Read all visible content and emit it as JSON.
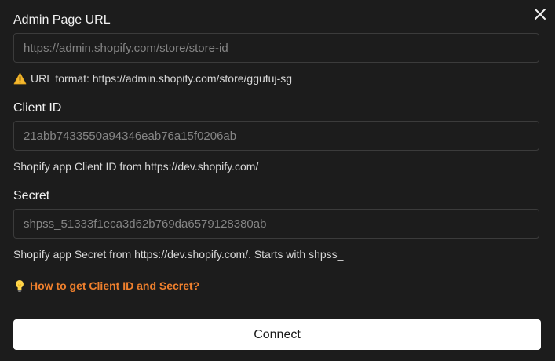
{
  "admin_url": {
    "label": "Admin Page URL",
    "placeholder": "https://admin.shopify.com/store/store-id",
    "value": "",
    "hint": "URL format: https://admin.shopify.com/store/ggufuj-sg",
    "hint_icon": "warning-icon"
  },
  "client_id": {
    "label": "Client ID",
    "placeholder": "21abb7433550a94346eab76a15f0206ab",
    "value": "",
    "hint": "Shopify app Client ID from https://dev.shopify.com/"
  },
  "secret": {
    "label": "Secret",
    "placeholder": "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",
    "value": "",
    "hint": "Shopify app Secret from https://dev.shopify.com/. Starts with shpss_"
  },
  "help": {
    "icon": "lightbulb-icon",
    "text": "How to get Client ID and Secret?"
  },
  "actions": {
    "connect_label": "Connect",
    "close_icon": "close-icon"
  },
  "colors": {
    "background": "#1c1c1c",
    "link_accent": "#f0802d",
    "button_bg": "#ffffff",
    "input_border": "#3b3b3b"
  }
}
